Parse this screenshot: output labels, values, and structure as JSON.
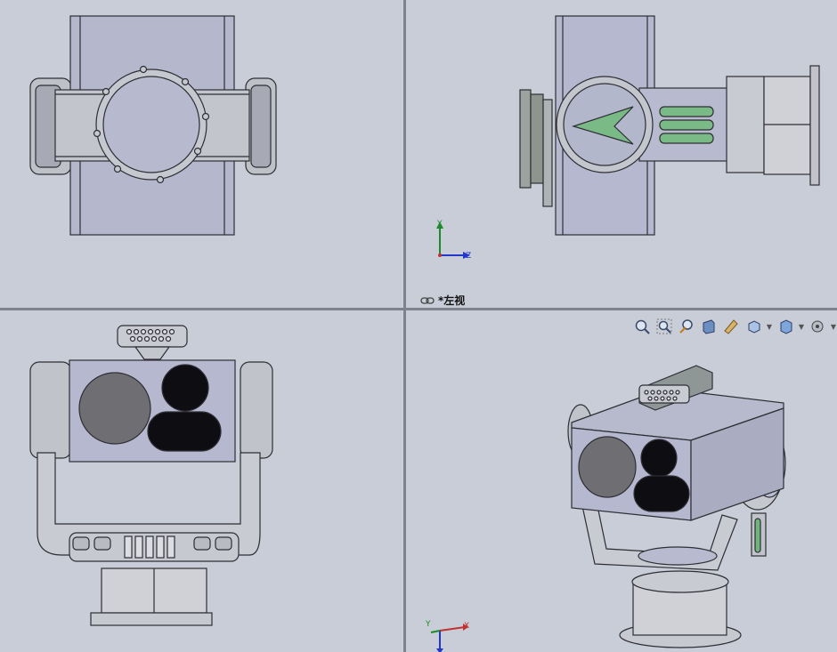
{
  "viewports": {
    "top_right": {
      "view_label": "*左视"
    }
  },
  "toolbar": {
    "items": [
      "zoom-to-fit-icon",
      "zoom-to-area-icon",
      "previous-view-icon",
      "section-view-icon",
      "view-orientation-icon",
      "display-style-icon",
      "hide-show-items-icon",
      "edit-appearance-icon"
    ]
  },
  "triad_top_right": {
    "y_label": "Y",
    "z_label": "Z"
  },
  "triad_bottom_right": {
    "y_label": "Y",
    "x_label": "X"
  },
  "colors": {
    "background": "#c8cdd7",
    "body": "#b3b7cd",
    "metal": "#c9cbd3",
    "dark": "#3a3a3a",
    "accent_green": "#7aba86"
  }
}
